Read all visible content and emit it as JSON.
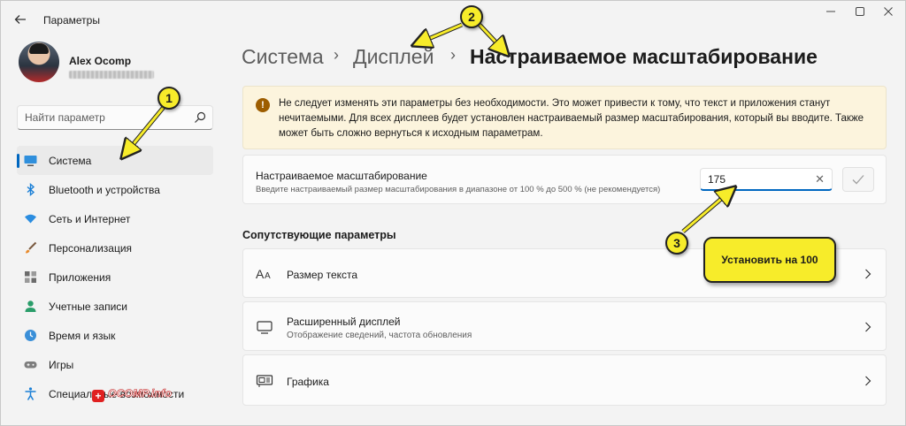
{
  "window": {
    "title": "Параметры",
    "back_icon": "arrow-left-icon",
    "controls": [
      "minimize-icon",
      "maximize-icon",
      "close-icon"
    ]
  },
  "user": {
    "name": "Alex Ocomp"
  },
  "search": {
    "placeholder": "Найти параметр",
    "icon": "search-icon"
  },
  "sidebar": {
    "items": [
      {
        "label": "Система",
        "icon": "monitor-icon",
        "active": true
      },
      {
        "label": "Bluetooth и устройства",
        "icon": "bluetooth-icon"
      },
      {
        "label": "Сеть и Интернет",
        "icon": "wifi-icon"
      },
      {
        "label": "Персонализация",
        "icon": "brush-icon"
      },
      {
        "label": "Приложения",
        "icon": "apps-icon"
      },
      {
        "label": "Учетные записи",
        "icon": "person-icon"
      },
      {
        "label": "Время и язык",
        "icon": "globe-clock-icon"
      },
      {
        "label": "Игры",
        "icon": "gamepad-icon"
      },
      {
        "label": "Специальные возможности",
        "icon": "accessibility-icon"
      }
    ]
  },
  "breadcrumb": {
    "items": [
      "Система",
      "Дисплей",
      "Настраиваемое масштабирование"
    ],
    "separator": "›"
  },
  "warning": {
    "icon": "warning-icon",
    "text": "Не следует изменять эти параметры без необходимости. Это может привести к тому, что текст и приложения станут нечитаемыми. Для всех дисплеев будет установлен настраиваемый размер масштабирования, который вы вводите. Также может быть сложно вернуться к исходным параметрам."
  },
  "custom_scaling": {
    "title": "Настраиваемое масштабирование",
    "description": "Введите настраиваемый размер масштабирования в диапазоне от 100 % до 500 % (не рекомендуется)",
    "value": "175",
    "clear_label": "✕",
    "apply_icon": "checkmark-icon"
  },
  "related": {
    "title": "Сопутствующие параметры",
    "items": [
      {
        "label": "Размер текста",
        "icon": "text-size-icon"
      },
      {
        "label": "Расширенный дисплей",
        "sub": "Отображение сведений, частота обновления",
        "icon": "display-icon"
      },
      {
        "label": "Графика",
        "icon": "graphics-card-icon"
      }
    ]
  },
  "annotations": {
    "callouts": [
      "1",
      "2",
      "3"
    ],
    "note": "Установить на 100",
    "color": "#f7ec2a"
  },
  "watermark": {
    "badge": "+",
    "text": "OCOMP.info"
  },
  "colors": {
    "accent": "#0067c0",
    "warning_bg": "#fcf4dd",
    "warning_icon": "#9d5d00"
  }
}
